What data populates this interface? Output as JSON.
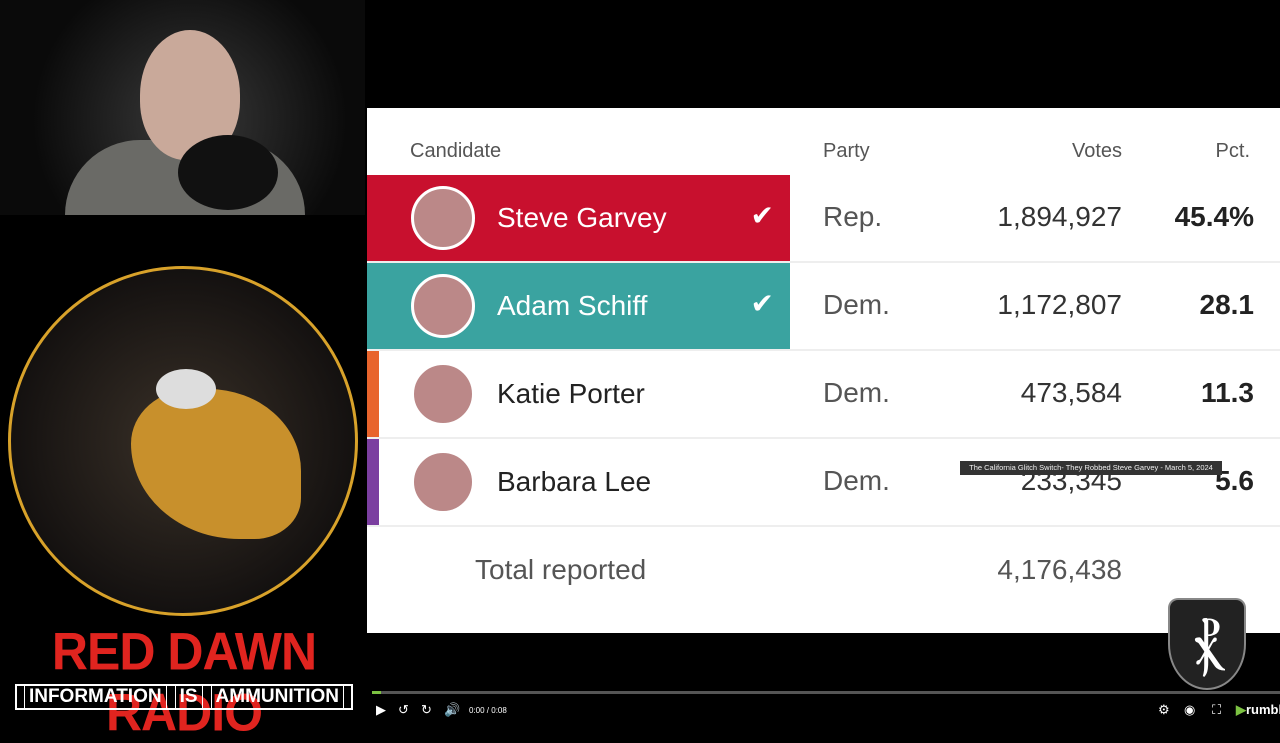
{
  "stream": {
    "brand": "RED DAWN RADIO",
    "tagline": [
      "INFORMATION",
      "IS",
      "AMMUNITION"
    ]
  },
  "table": {
    "headers": {
      "candidate": "Candidate",
      "party": "Party",
      "votes": "Votes",
      "pct": "Pct."
    },
    "rows": [
      {
        "name": "Steve Garvey",
        "party": "Rep.",
        "votes": "1,894,927",
        "pct": "45.4%",
        "color": "#c8102e",
        "winner": true
      },
      {
        "name": "Adam Schiff",
        "party": "Dem.",
        "votes": "1,172,807",
        "pct": "28.1",
        "color": "#3aa3a0",
        "winner": true
      },
      {
        "name": "Katie Porter",
        "party": "Dem.",
        "votes": "473,584",
        "pct": "11.3",
        "color": "#e8642c",
        "winner": false
      },
      {
        "name": "Barbara Lee",
        "party": "Dem.",
        "votes": "233,345",
        "pct": "5.6",
        "color": "#7b3fa0",
        "winner": false
      }
    ],
    "total_label": "Total reported",
    "total_votes": "4,176,438"
  },
  "player": {
    "tooltip": "The California Glitch Switch- They Robbed Steve Garvey - March 5, 2024",
    "time": "0:00 / 0:08",
    "progress": 0.01,
    "brand": "rumble",
    "accent": "#7cc242"
  }
}
